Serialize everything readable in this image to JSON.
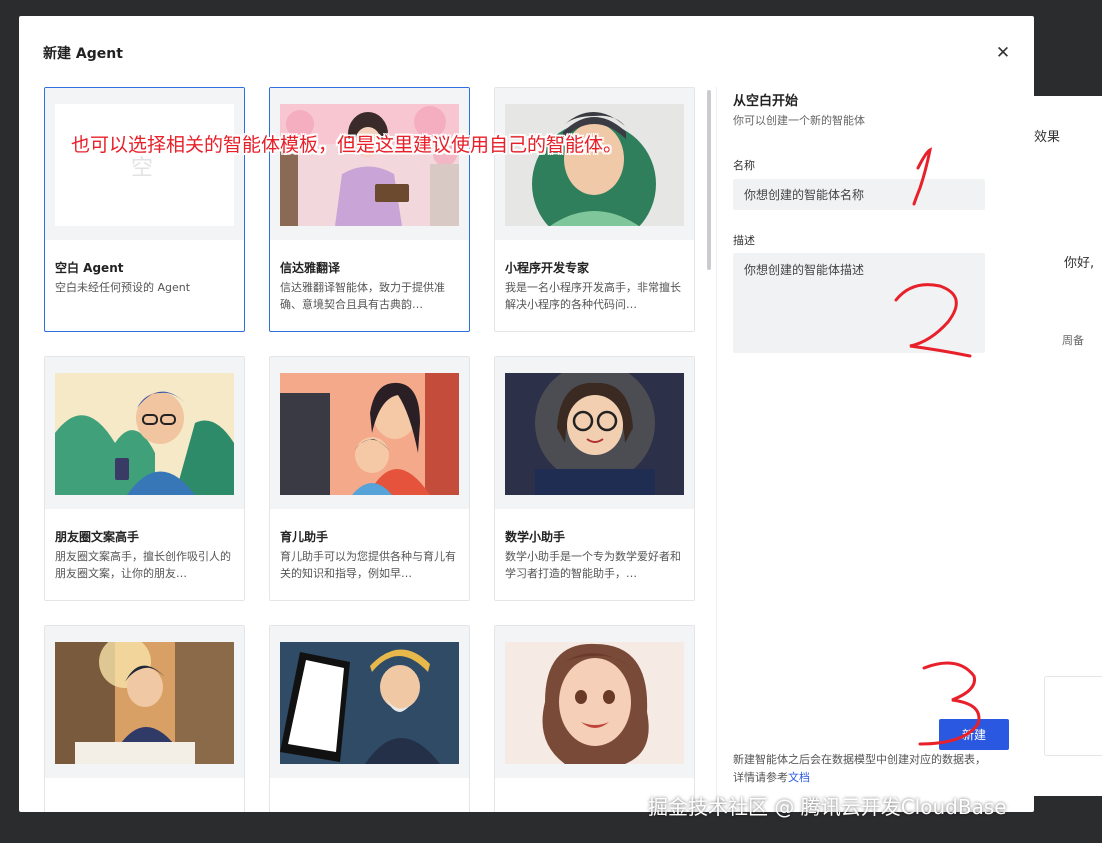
{
  "background": {
    "effect_label": "效果",
    "greeting": "你好,",
    "misc": "周备"
  },
  "modal": {
    "title": "新建 Agent",
    "close_icon": "close-icon"
  },
  "templates": [
    {
      "name": "空白 Agent",
      "desc": "空白未经任何预设的 Agent",
      "thumb_text": "空",
      "selected": true
    },
    {
      "name": "信达雅翻译",
      "desc": "信达雅翻译智能体，致力于提供准确、意境契合且具有古典韵…",
      "selected": true
    },
    {
      "name": "小程序开发专家",
      "desc": "我是一名小程序开发高手，非常擅长解决小程序的各种代码问…",
      "selected": false
    },
    {
      "name": "朋友圈文案高手",
      "desc": "朋友圈文案高手，擅长创作吸引人的朋友圈文案，让你的朋友…",
      "selected": false
    },
    {
      "name": "育儿助手",
      "desc": "育儿助手可以为您提供各种与育儿有关的知识和指导，例如早…",
      "selected": false
    },
    {
      "name": "数学小助手",
      "desc": "数学小助手是一个专为数学爱好者和学习者打造的智能助手，…",
      "selected": false
    },
    {
      "name": "",
      "desc": "",
      "selected": false
    },
    {
      "name": "",
      "desc": "",
      "selected": false
    },
    {
      "name": "",
      "desc": "",
      "selected": false
    }
  ],
  "form": {
    "title": "从空白开始",
    "subtitle": "你可以创建一个新的智能体",
    "name_label": "名称",
    "name_placeholder": "你想创建的智能体名称",
    "desc_label": "描述",
    "desc_placeholder": "你想创建的智能体描述",
    "create_label": "新建",
    "note_text": "新建智能体之后会在数据模型中创建对应的数据表，详情请参考",
    "note_link": "文档"
  },
  "annotation": {
    "text": "也可以选择相关的智能体模板，但是这里建议使用自己的智能体。",
    "marks": [
      "1",
      "2",
      "3"
    ]
  },
  "watermark": "掘金技术社区 @ 腾讯云开发CloudBase",
  "colors": {
    "accent": "#2b58e0",
    "selected_border": "#2f6fe0",
    "annotation_red": "#e8202a"
  }
}
